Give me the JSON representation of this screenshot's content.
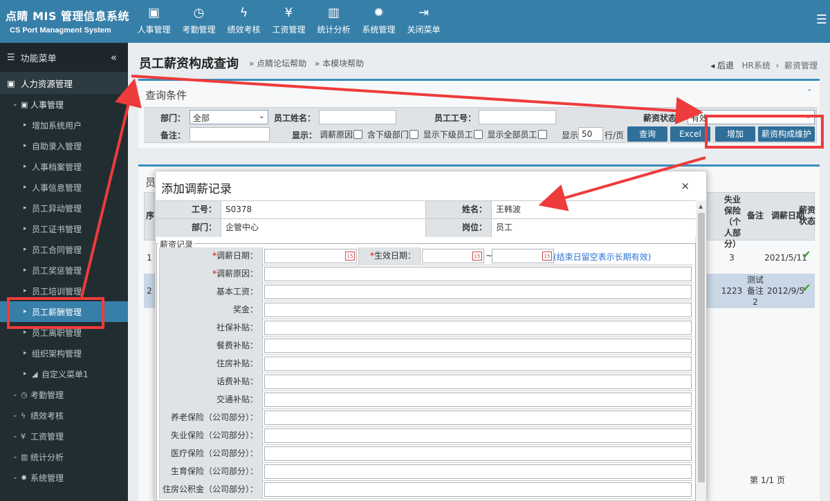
{
  "header": {
    "title": "点睛 MIS 管理信息系统",
    "subtitle": "CS Port Managment System",
    "nav": [
      {
        "label": "人事管理",
        "icon": "id-card-icon",
        "glyph": "▣"
      },
      {
        "label": "考勤管理",
        "icon": "clock-icon",
        "glyph": "◷"
      },
      {
        "label": "绩效考核",
        "icon": "bolt-icon",
        "glyph": "ϟ"
      },
      {
        "label": "工资管理",
        "icon": "yen-icon",
        "glyph": "¥"
      },
      {
        "label": "统计分析",
        "icon": "bar-chart-icon",
        "glyph": "▥"
      },
      {
        "label": "系统管理",
        "icon": "gear-icon",
        "glyph": "✹"
      },
      {
        "label": "关闭菜单",
        "icon": "sign-out-icon",
        "glyph": "⇥"
      }
    ]
  },
  "sidebar": {
    "head": "功能菜单",
    "section": "人力资源管理",
    "group": "人事管理",
    "items": [
      "增加系统用户",
      "自助录入管理",
      "人事档案管理",
      "人事信息管理",
      "员工异动管理",
      "员工证书管理",
      "员工合同管理",
      "员工奖惩管理",
      "员工培训管理",
      "员工薪酬管理",
      "员工离职管理",
      "组织架构管理",
      "自定义菜单1"
    ],
    "others": [
      "考勤管理",
      "绩效考核",
      "工资管理",
      "统计分析",
      "系统管理"
    ]
  },
  "page": {
    "title": "员工薪资构成查询",
    "help1": "» 点睛论坛帮助",
    "help2": "» 本模块帮助",
    "back": "◂ 后退",
    "crumb1": "HR系统",
    "sep": "›",
    "crumb2": "薪资管理"
  },
  "query": {
    "title": "查询条件",
    "dept_label": "部门：",
    "dept_value": "全部",
    "name_label": "员工姓名：",
    "code_label": "员工工号：",
    "status_label": "薪资状态",
    "status_value": "有效",
    "remark_label": "备注：",
    "show_label": "显示：",
    "opt1": "调薪原因",
    "opt2": "含下级部门",
    "opt3": "显示下级员工",
    "opt4": "显示全部员工",
    "page_pre": "显示",
    "page_size": "50",
    "page_post": "行/页",
    "btn_query": "查询",
    "btn_excel": "Excel",
    "btn_add": "增加",
    "btn_maint": "薪资构成维护"
  },
  "list": {
    "title_partial": "员",
    "col_seq": "序",
    "col_unemp": "失业保险（个人部分）",
    "col_remark": "备注",
    "col_date": "调薪日期",
    "col_status": "薪资状态",
    "rows": [
      {
        "seq": "1",
        "unemp": "3",
        "remark": "",
        "date": "2021/5/11"
      },
      {
        "seq": "2",
        "unemp": "1223",
        "remark": "测试备注2",
        "date": "2012/9/5"
      }
    ],
    "pager": "第 1/1 页"
  },
  "modal": {
    "title": "添加调薪记录",
    "close": "×",
    "code_label": "工号：",
    "code_value": "S0378",
    "name_label": "姓名：",
    "name_value": "王韩波",
    "dept_label": "部门：",
    "dept_value": "企管中心",
    "post_label": "岗位：",
    "post_value": "员工",
    "legend": "薪资记录",
    "adj_date_label": "调薪日期：",
    "eff_date_label": "生效日期：",
    "tilde": "~",
    "date_note": "(结束日留空表示长期有效)",
    "req_mark": "*",
    "cal": "15",
    "fields": [
      "调薪原因：",
      "基本工资：",
      "奖金：",
      "社保补贴：",
      "餐费补贴：",
      "住房补贴：",
      "话费补贴：",
      "交通补贴：",
      "养老保险（公司部分）：",
      "失业保险（公司部分）：",
      "医疗保险（公司部分）：",
      "生育保险（公司部分）：",
      "住房公积金（公司部分）："
    ]
  },
  "colors": {
    "header": "#367fa9",
    "sidebar": "#222d32",
    "active": "#367fa9",
    "annotation": "#ee3b3b"
  }
}
